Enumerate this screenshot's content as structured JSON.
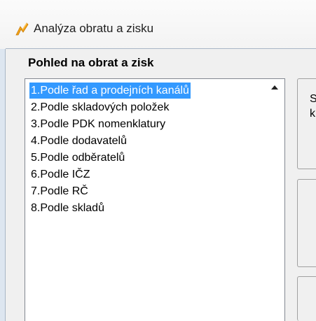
{
  "window": {
    "title": "Analýza obratu a zisku",
    "accent": "#3399ff"
  },
  "group": {
    "title": "Pohled na obrat a zisk"
  },
  "list": {
    "selected_index": 0,
    "items": [
      "1.Podle řad a prodejních kanálů",
      "2.Podle skladových položek",
      "3.Podle PDK nomenklatury",
      "4.Podle dodavatelů",
      "5.Podle odběratelů",
      "6.Podle IČZ",
      "7.Podle RČ",
      "8.Podle skladů"
    ]
  },
  "right_panels": {
    "panel1_line1": "S",
    "panel1_line2": "k"
  }
}
